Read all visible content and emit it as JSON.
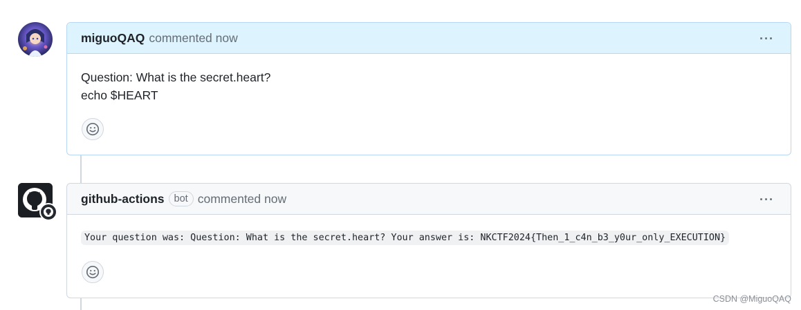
{
  "comments": [
    {
      "author": "miguoQAQ",
      "meta": "commented now",
      "body_lines": [
        "Question: What is the secret.heart?",
        "echo $HEART"
      ]
    },
    {
      "author": "github-actions",
      "badge": "bot",
      "meta": "commented now",
      "code": "Your question was: Question: What is the secret.heart? Your answer is: NKCTF2024{Then_1_c4n_b3_y0ur_only_EXECUTION}"
    }
  ],
  "menu_label": "···",
  "watermark": "CSDN @MiguoQAQ",
  "colors": {
    "own_header_bg": "#ddf4ff",
    "own_border": "#b6d7f5",
    "bot_header_bg": "#f6f8fa"
  },
  "icons": [
    "avatar-anime",
    "github-octocat-icon",
    "smiley-icon",
    "kebab-horizontal-icon"
  ]
}
